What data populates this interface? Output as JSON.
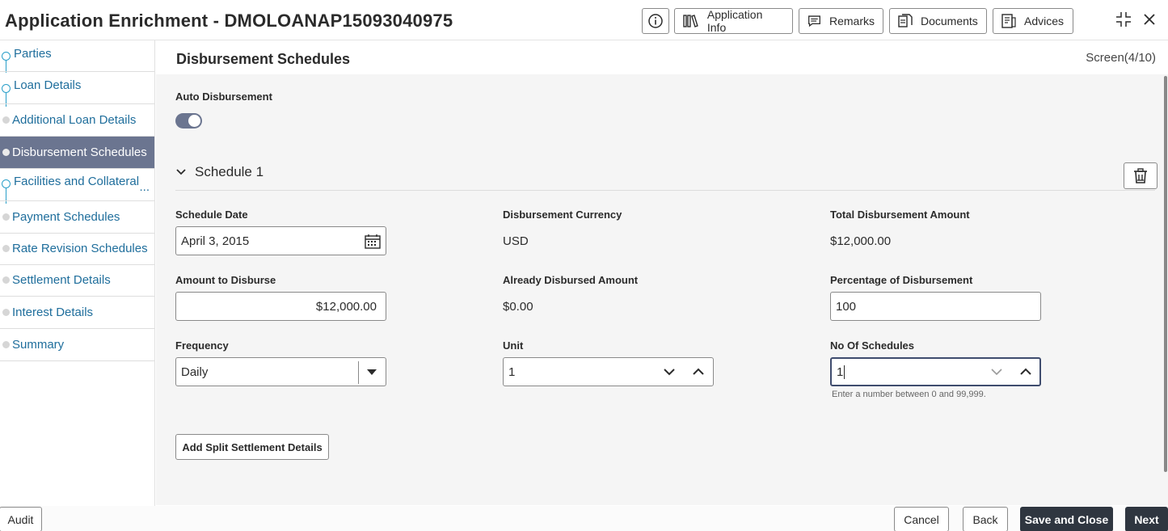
{
  "header": {
    "title": "Application Enrichment - DMOLOANAP15093040975",
    "buttons": {
      "application_info": "Application Info",
      "remarks": "Remarks",
      "documents": "Documents",
      "advices": "Advices"
    }
  },
  "sidebar": {
    "items": [
      {
        "label": "Parties",
        "state": "complete"
      },
      {
        "label": "Loan Details",
        "state": "complete"
      },
      {
        "label": "Additional Loan Details",
        "state": "pending"
      },
      {
        "label": "Disbursement Schedules",
        "state": "active"
      },
      {
        "label": "Facilities and Collateral",
        "state": "complete"
      },
      {
        "label": "Payment Schedules",
        "state": "pending"
      },
      {
        "label": "Rate Revision Schedules",
        "state": "pending"
      },
      {
        "label": "Settlement Details",
        "state": "pending"
      },
      {
        "label": "Interest Details",
        "state": "pending"
      },
      {
        "label": "Summary",
        "state": "pending"
      }
    ],
    "more": "..."
  },
  "main": {
    "title": "Disbursement Schedules",
    "screen": "Screen(4/10)",
    "auto_disbursement": {
      "label": "Auto Disbursement",
      "enabled": true
    },
    "schedule": {
      "title": "Schedule 1",
      "schedule_date": {
        "label": "Schedule Date",
        "value": "April 3, 2015"
      },
      "disbursement_currency": {
        "label": "Disbursement Currency",
        "value": "USD"
      },
      "total_disbursement_amount": {
        "label": "Total Disbursement Amount",
        "value": "$12,000.00"
      },
      "amount_to_disburse": {
        "label": "Amount to Disburse",
        "value": "$12,000.00"
      },
      "already_disbursed_amount": {
        "label": "Already Disbursed Amount",
        "value": "$0.00"
      },
      "percentage_of_disbursement": {
        "label": "Percentage of Disbursement",
        "value": "100"
      },
      "frequency": {
        "label": "Frequency",
        "value": "Daily"
      },
      "unit": {
        "label": "Unit",
        "value": "1"
      },
      "no_of_schedules": {
        "label": "No Of Schedules",
        "value": "1",
        "hint": "Enter a number between 0 and 99,999."
      }
    },
    "add_split_button": "Add Split Settlement Details"
  },
  "footer": {
    "audit": "Audit",
    "cancel": "Cancel",
    "back": "Back",
    "save_close": "Save and Close",
    "next": "Next"
  },
  "colors": {
    "active_nav": "#6b7590",
    "link_blue": "#1f6e9c",
    "primary_dark": "#2f3640",
    "step_line": "#2a9fc9"
  }
}
